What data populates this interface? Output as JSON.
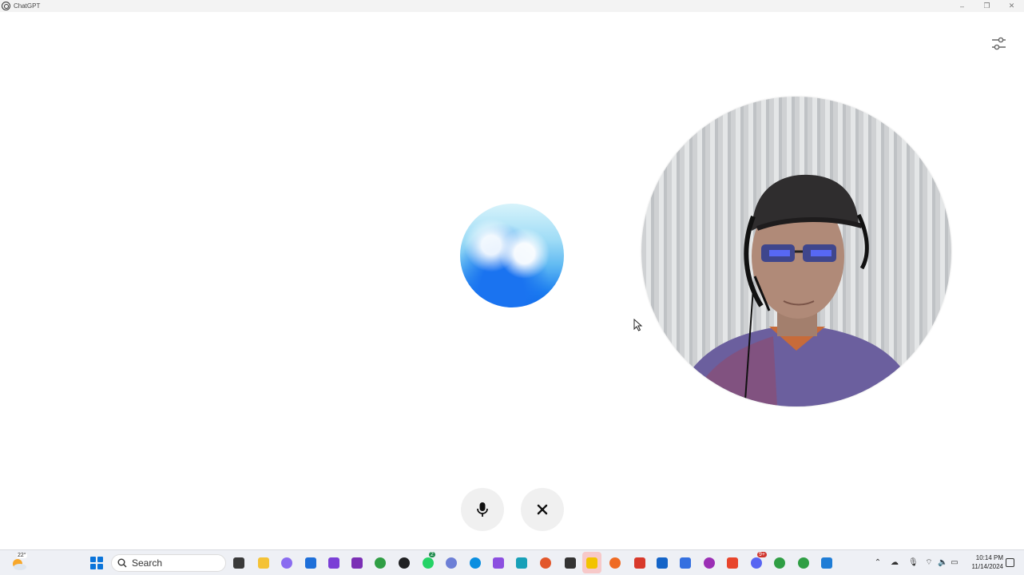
{
  "window": {
    "title": "ChatGPT",
    "controls": {
      "minimize": "–",
      "maximize": "❐",
      "close": "✕"
    }
  },
  "voice_mode": {
    "settings_icon": "sliders-icon",
    "mic_icon": "microphone-icon",
    "end_icon": "close-icon",
    "orb_colors": [
      "#d7f3fb",
      "#5fb9f2",
      "#0a66e6"
    ]
  },
  "taskbar": {
    "weather_temp": "22°",
    "search_placeholder": "Search",
    "apps": [
      {
        "name": "task-view",
        "color": "#3a3a3a"
      },
      {
        "name": "file-explorer",
        "color": "#f4c236"
      },
      {
        "name": "copilot",
        "color": "#8a6cf0"
      },
      {
        "name": "microsoft-store",
        "color": "#1e6fd9"
      },
      {
        "name": "app-purple",
        "color": "#7a3fd6"
      },
      {
        "name": "onenote",
        "color": "#7b2fb5"
      },
      {
        "name": "chrome",
        "color": "#2f9e44"
      },
      {
        "name": "chatgpt",
        "color": "#202123"
      },
      {
        "name": "whatsapp",
        "color": "#25d366"
      },
      {
        "name": "settings",
        "color": "#6d7fd6"
      },
      {
        "name": "skype",
        "color": "#0a8ee0"
      },
      {
        "name": "app-violet",
        "color": "#8c4fe0"
      },
      {
        "name": "app-teal",
        "color": "#17a0b8"
      },
      {
        "name": "app-orange",
        "color": "#e2572b"
      },
      {
        "name": "app-s",
        "color": "#333333"
      },
      {
        "name": "sticky-notes",
        "color": "#f2c300"
      },
      {
        "name": "firefox",
        "color": "#ef6b24"
      },
      {
        "name": "app-red",
        "color": "#d8392b"
      },
      {
        "name": "mail",
        "color": "#1464c8"
      },
      {
        "name": "app-blue",
        "color": "#3570e0"
      },
      {
        "name": "app-magenta",
        "color": "#9b2fb5"
      },
      {
        "name": "app-s-red",
        "color": "#e8452c"
      },
      {
        "name": "discord",
        "color": "#5865f2"
      },
      {
        "name": "chrome-2",
        "color": "#2f9e44"
      },
      {
        "name": "chrome-3",
        "color": "#2f9e44"
      },
      {
        "name": "app-s-blue",
        "color": "#1f7dd6"
      }
    ],
    "whatsapp_badge": "2",
    "discord_badge": "9+",
    "clock": {
      "time": "10:14 PM",
      "date": "11/14/2024"
    }
  }
}
